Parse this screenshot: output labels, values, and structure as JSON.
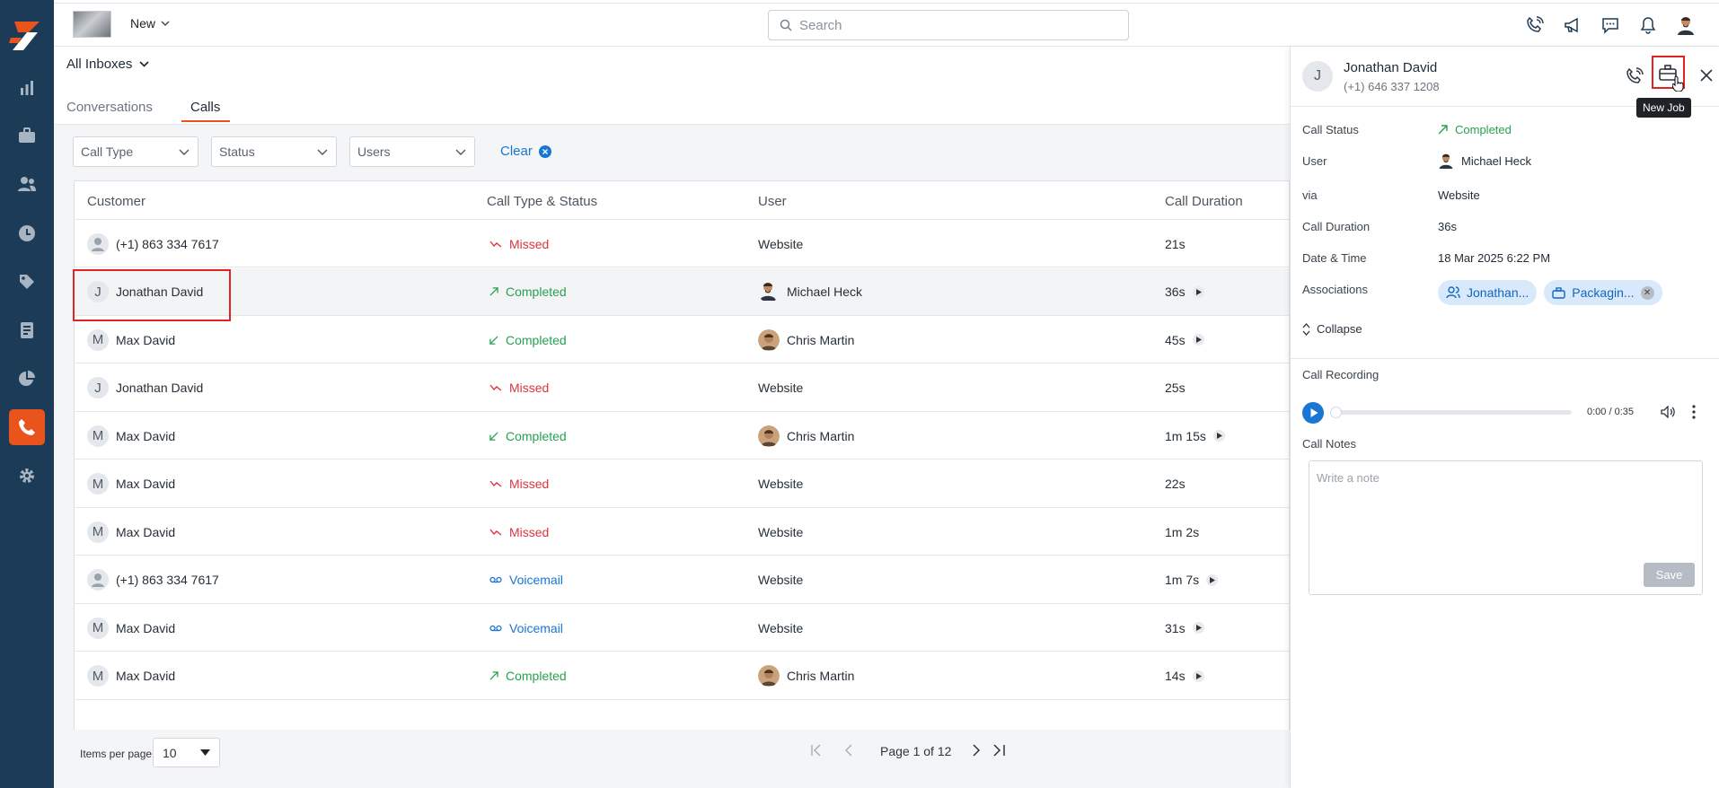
{
  "topbar": {
    "new_label": "New",
    "search_placeholder": "Search"
  },
  "inbox": {
    "label": "All Inboxes"
  },
  "tabs": [
    {
      "label": "Conversations"
    },
    {
      "label": "Calls"
    }
  ],
  "filters": {
    "call_type": "Call Type",
    "status": "Status",
    "users": "Users",
    "clear": "Clear"
  },
  "table": {
    "headers": [
      "Customer",
      "Call Type & Status",
      "User",
      "Call Duration"
    ],
    "rows": [
      {
        "avatar": "",
        "customer": "(+1) 863 334 7617",
        "status": "Missed",
        "user": "Website",
        "duration": "21s"
      },
      {
        "avatar": "J",
        "customer": "Jonathan David",
        "status": "Completed",
        "user": "Michael Heck",
        "duration": "36s"
      },
      {
        "avatar": "M",
        "customer": "Max David",
        "status": "Completed",
        "user": "Chris Martin",
        "duration": "45s"
      },
      {
        "avatar": "J",
        "customer": "Jonathan David",
        "status": "Missed",
        "user": "Website",
        "duration": "25s"
      },
      {
        "avatar": "M",
        "customer": "Max David",
        "status": "Completed",
        "user": "Chris Martin",
        "duration": "1m 15s"
      },
      {
        "avatar": "M",
        "customer": "Max David",
        "status": "Missed",
        "user": "Website",
        "duration": "22s"
      },
      {
        "avatar": "M",
        "customer": "Max David",
        "status": "Missed",
        "user": "Website",
        "duration": "1m 2s"
      },
      {
        "avatar": "",
        "customer": "(+1) 863 334 7617",
        "status": "Voicemail",
        "user": "Website",
        "duration": "1m 7s"
      },
      {
        "avatar": "M",
        "customer": "Max David",
        "status": "Voicemail",
        "user": "Website",
        "duration": "31s"
      },
      {
        "avatar": "M",
        "customer": "Max David",
        "status": "Completed",
        "user": "Chris Martin",
        "duration": "14s"
      }
    ]
  },
  "pager": {
    "items_label": "Items per page",
    "per_page": "10",
    "page_label": "Page 1 of 12"
  },
  "panel": {
    "avatar": "J",
    "name": "Jonathan David",
    "phone": "(+1) 646 337 1208",
    "tooltip": "New Job",
    "details": {
      "call_status_label": "Call Status",
      "call_status": "Completed",
      "user_label": "User",
      "user": "Michael Heck",
      "via_label": "via",
      "via": "Website",
      "duration_label": "Call Duration",
      "duration": "36s",
      "datetime_label": "Date & Time",
      "datetime": "18 Mar 2025 6:22 PM",
      "assoc_label": "Associations",
      "assoc_contact": "Jonathan...",
      "assoc_job": "Packagin...",
      "collapse": "Collapse"
    },
    "recording_label": "Call Recording",
    "recording_time": "0:00 / 0:35",
    "notes_label": "Call Notes",
    "notes_placeholder": "Write a note",
    "save_label": "Save"
  },
  "colors": {
    "sidebar": "#1c3b57",
    "accent": "#e8541c",
    "missed": "#d9363e",
    "completed": "#28a050",
    "voicemail": "#1976d2",
    "link": "#1976d2"
  }
}
